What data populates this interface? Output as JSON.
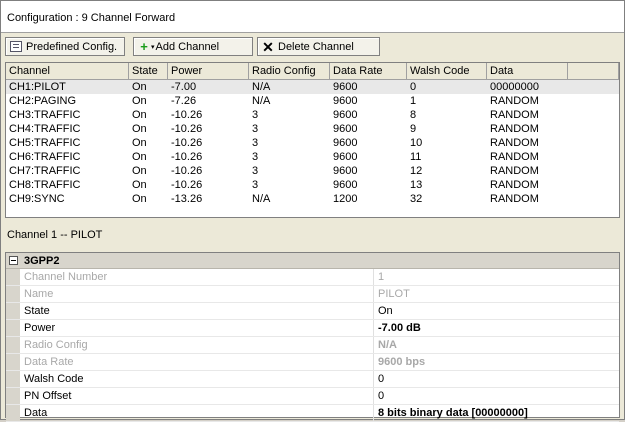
{
  "config_title": "Configuration : 9 Channel Forward",
  "toolbar": {
    "predefined": "Predefined Config.",
    "add": "Add Channel",
    "delete": "Delete Channel"
  },
  "grid": {
    "headers": [
      "Channel",
      "State",
      "Power",
      "Radio Config",
      "Data Rate",
      "Walsh Code",
      "Data"
    ],
    "rows": [
      [
        "CH1:PILOT",
        "On",
        "-7.00",
        "N/A",
        "9600",
        "0",
        "00000000"
      ],
      [
        "CH2:PAGING",
        "On",
        "-7.26",
        "N/A",
        "9600",
        "1",
        "RANDOM"
      ],
      [
        "CH3:TRAFFIC",
        "On",
        "-10.26",
        "3",
        "9600",
        "8",
        "RANDOM"
      ],
      [
        "CH4:TRAFFIC",
        "On",
        "-10.26",
        "3",
        "9600",
        "9",
        "RANDOM"
      ],
      [
        "CH5:TRAFFIC",
        "On",
        "-10.26",
        "3",
        "9600",
        "10",
        "RANDOM"
      ],
      [
        "CH6:TRAFFIC",
        "On",
        "-10.26",
        "3",
        "9600",
        "11",
        "RANDOM"
      ],
      [
        "CH7:TRAFFIC",
        "On",
        "-10.26",
        "3",
        "9600",
        "12",
        "RANDOM"
      ],
      [
        "CH8:TRAFFIC",
        "On",
        "-10.26",
        "3",
        "9600",
        "13",
        "RANDOM"
      ],
      [
        "CH9:SYNC",
        "On",
        "-13.26",
        "N/A",
        "1200",
        "32",
        "RANDOM"
      ]
    ]
  },
  "channel_label": "Channel 1 -- PILOT",
  "props": {
    "section": "3GPP2",
    "rows": [
      {
        "name": "Channel Number",
        "value": "1",
        "disabled": true,
        "bold": false
      },
      {
        "name": "Name",
        "value": "PILOT",
        "disabled": true,
        "bold": false
      },
      {
        "name": "State",
        "value": "On",
        "disabled": false,
        "bold": false
      },
      {
        "name": "Power",
        "value": "-7.00 dB",
        "disabled": false,
        "bold": true
      },
      {
        "name": "Radio Config",
        "value": "N/A",
        "disabled": true,
        "bold": true
      },
      {
        "name": "Data Rate",
        "value": "9600 bps",
        "disabled": true,
        "bold": true
      },
      {
        "name": "Walsh Code",
        "value": "0",
        "disabled": false,
        "bold": false
      },
      {
        "name": "PN Offset",
        "value": "0",
        "disabled": false,
        "bold": false
      },
      {
        "name": "Data",
        "value": "8 bits binary data [00000000]",
        "disabled": false,
        "bold": true
      }
    ]
  }
}
